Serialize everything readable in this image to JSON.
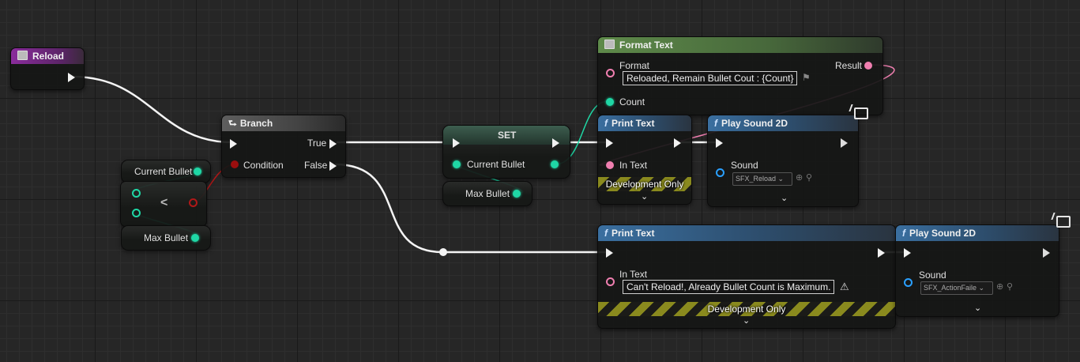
{
  "nodes": {
    "reload": {
      "title": "Reload"
    },
    "branch": {
      "title": "Branch",
      "condition": "Condition",
      "true_label": "True",
      "false_label": "False"
    },
    "current_bullet_get": {
      "label": "Current Bullet"
    },
    "less_than": {
      "symbol": "<"
    },
    "max_bullet_get": {
      "label": "Max Bullet"
    },
    "set": {
      "title": "SET",
      "pin_label": "Current Bullet"
    },
    "max_bullet_get2": {
      "label": "Max Bullet"
    },
    "format_text": {
      "title": "Format Text",
      "format_label": "Format",
      "format_value": "Reloaded, Remain Bullet Cout : {Count}",
      "count_label": "Count",
      "result_label": "Result"
    },
    "print_text_1": {
      "title": "Print Text",
      "in_text_label": "In Text",
      "dev_only": "Development Only"
    },
    "play_sound_1": {
      "title": "Play Sound 2D",
      "sound_label": "Sound",
      "sound_value": "SFX_Reload"
    },
    "print_text_2": {
      "title": "Print Text",
      "in_text_label": "In Text",
      "in_text_value": "Can't Reload!, Already Bullet Count is Maximum.",
      "dev_only": "Development Only"
    },
    "play_sound_2": {
      "title": "Play Sound 2D",
      "sound_label": "Sound",
      "sound_value": "SFX_ActionFaile"
    }
  },
  "icons": {
    "function": "f",
    "branch": "branch-icon",
    "event": "event-icon",
    "flag": "flag-icon",
    "warning": "warning-icon",
    "chevron": "chevron-down-icon",
    "client": "client-only-icon"
  },
  "colors": {
    "exec": "#f2f2f2",
    "bool": "#9b0e0e",
    "integer": "#1fd7a5",
    "text": "#f07fb0",
    "object": "#2aa0ff",
    "event_header": "#8a2c9c",
    "function_header": "#3a6fa0",
    "pure_header": "#5e8a4a"
  }
}
